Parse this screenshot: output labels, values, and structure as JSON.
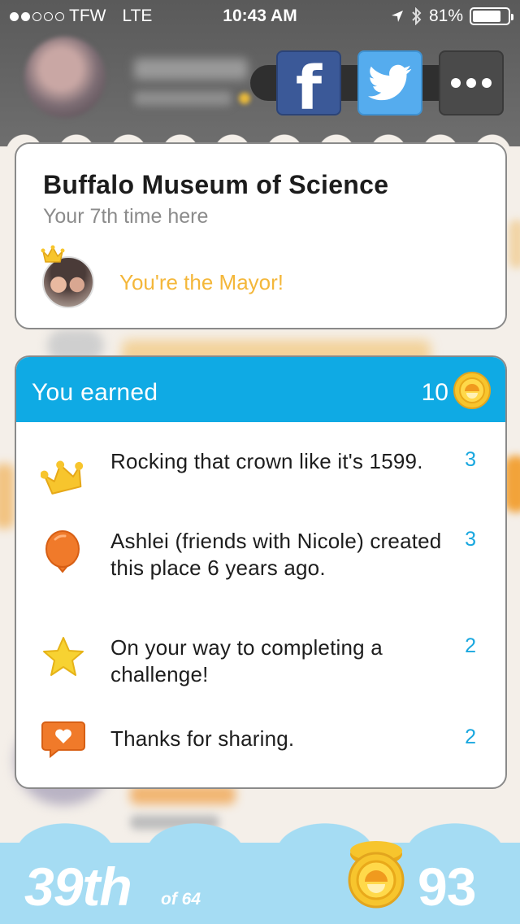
{
  "status_bar": {
    "carrier": "TFW",
    "network": "LTE",
    "time": "10:43 AM",
    "battery": "81%",
    "battery_level": 0.81
  },
  "share": {
    "facebook_icon": "facebook-icon",
    "twitter_icon": "twitter-icon",
    "more_icon": "more-icon"
  },
  "venue": {
    "name": "Buffalo Museum of Science",
    "visits": "Your 7th time here",
    "mayor_text": "You're the Mayor!"
  },
  "earned": {
    "title": "You earned",
    "total": "10",
    "rewards": [
      {
        "icon": "crown-icon",
        "text": "Rocking that crown like it's 1599.",
        "points": "3"
      },
      {
        "icon": "balloon-icon",
        "text": "Ashlei (friends with Nicole) created this place 6 years ago.",
        "points": "3"
      },
      {
        "icon": "star-icon",
        "text": "On your way to completing a challenge!",
        "points": "2"
      },
      {
        "icon": "heart-speech-icon",
        "text": "Thanks for sharing.",
        "points": "2"
      }
    ]
  },
  "footer": {
    "rank": "39th",
    "rank_of": "of 64",
    "score": "93"
  },
  "colors": {
    "accent_blue": "#0faae4",
    "mayor_gold": "#f4b73a",
    "footer_blue": "#a5dcf3",
    "facebook": "#3b5998",
    "twitter": "#55acee"
  }
}
